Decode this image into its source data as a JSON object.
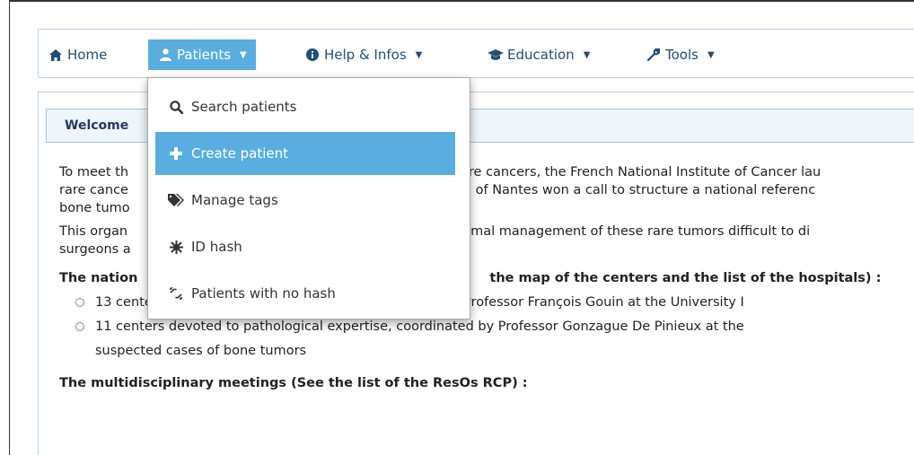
{
  "nav": {
    "home": {
      "label": "Home",
      "icon": "home-icon"
    },
    "patients": {
      "label": "Patients",
      "icon": "user-icon"
    },
    "help": {
      "label": "Help & Infos",
      "icon": "info-icon"
    },
    "education": {
      "label": "Education",
      "icon": "graduation-cap-icon"
    },
    "tools": {
      "label": "Tools",
      "icon": "wrench-icon"
    }
  },
  "dropdown": {
    "items": [
      {
        "label": "Search patients",
        "icon": "search-icon"
      },
      {
        "label": "Create patient",
        "icon": "plus-icon",
        "active": true
      },
      {
        "label": "Manage tags",
        "icon": "tags-icon"
      },
      {
        "label": "ID hash",
        "icon": "hash-icon"
      },
      {
        "label": "Patients with no hash",
        "icon": "broken-link-icon"
      }
    ]
  },
  "panel": {
    "header": "Welcome",
    "para1_line1_left": "To meet th",
    "para1_line1_right": "are cancers, the French National Institute of Cancer lau",
    "para1_line2_left": "rare cance",
    "para1_line2_right": "l of Nantes won a call to structure a national referenc",
    "para1_line3_left": "bone tumo",
    "para2_line1_left": "This organ",
    "para2_line1_right": "imal management of these rare tumors difficult to di",
    "para2_line2_left": "surgeons a",
    "network_title_left": "The nation",
    "network_title_right": "the map of the centers and the list of the hospitals) :",
    "bullets": [
      "13 centers devoted to clinical expertise, coordinated by Professor François Gouin at the University I",
      "11 centers devoted to pathological expertise, coordinated by Professor Gonzague De Pinieux at the"
    ],
    "bullet_continuation": "suspected cases of bone tumors",
    "meetings_title": "The multidisciplinary meetings (See the list of the ResOs RCP) :"
  },
  "colors": {
    "accent": "#5aaedf",
    "nav_text": "#1f4e79",
    "border": "#b9d3e8"
  }
}
